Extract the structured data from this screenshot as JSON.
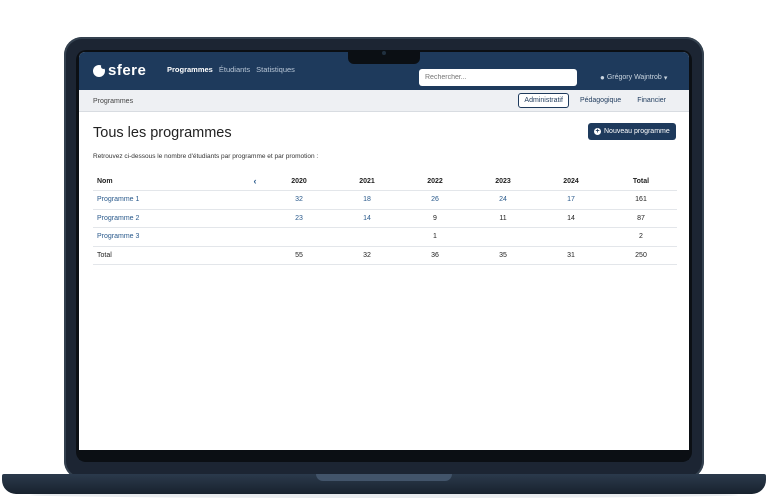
{
  "app": {
    "logo": "sfere"
  },
  "nav": {
    "items": [
      "Programmes",
      "Étudiants",
      "Statistiques"
    ]
  },
  "search": {
    "placeholder": "Rechercher..."
  },
  "user": {
    "name": "Grégory Wajntrob"
  },
  "breadcrumb": "Programmes",
  "views": [
    "Administratif",
    "Pédagogique",
    "Financier"
  ],
  "page": {
    "title": "Tous les programmes",
    "new_button": "Nouveau programme",
    "intro": "Retrouvez ci-dessous le nombre d'étudiants par programme et par promotion :"
  },
  "table": {
    "headers": [
      "Nom",
      "2020",
      "2021",
      "2022",
      "2023",
      "2024",
      "Total"
    ],
    "rows": [
      {
        "name": "Programme 1",
        "values": [
          "32",
          "18",
          "26",
          "24",
          "17",
          "161"
        ]
      },
      {
        "name": "Programme 2",
        "values": [
          "23",
          "14",
          "9",
          "11",
          "14",
          "87"
        ]
      },
      {
        "name": "Programme 3",
        "values": [
          "",
          "",
          "1",
          "",
          "",
          "2"
        ]
      }
    ],
    "total": {
      "name": "Total",
      "values": [
        "55",
        "32",
        "36",
        "35",
        "31",
        "250"
      ]
    }
  },
  "colors": {
    "primary": "#1e3a5c",
    "link": "#2a5a8c",
    "subbar": "#eef0f3"
  }
}
